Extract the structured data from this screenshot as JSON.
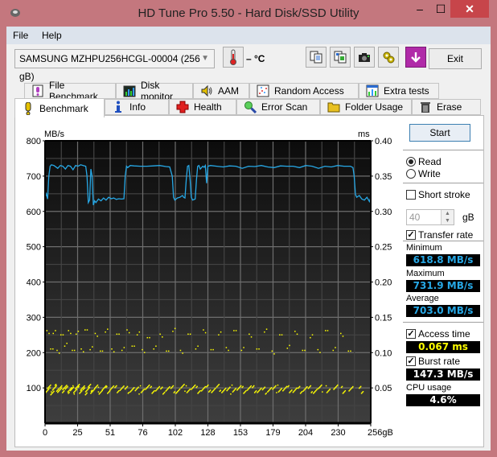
{
  "window": {
    "title": "HD Tune Pro 5.50 - Hard Disk/SSD Utility",
    "minimize": "–",
    "maximize": "☐",
    "close": "✕"
  },
  "menu": [
    {
      "label": "File"
    },
    {
      "label": "Help"
    }
  ],
  "toolbar": {
    "drive": "SAMSUNG MZHPU256HCGL-00004 (256 gB)",
    "temperature": "– °C",
    "exit_label": "Exit",
    "icons": [
      "copy-text-icon",
      "copy-screenshot-icon",
      "camera-icon",
      "options-icon",
      "save-download-icon"
    ]
  },
  "tabs_top": [
    {
      "label": "File Benchmark",
      "icon": "file-benchmark-icon"
    },
    {
      "label": "Disk monitor",
      "icon": "disk-monitor-icon"
    },
    {
      "label": "AAM",
      "icon": "speaker-icon"
    },
    {
      "label": "Random Access",
      "icon": "random-access-icon"
    },
    {
      "label": "Extra tests",
      "icon": "extra-tests-icon"
    }
  ],
  "tabs_bottom": [
    {
      "label": "Benchmark",
      "icon": "exclamation-icon",
      "active": true
    },
    {
      "label": "Info",
      "icon": "info-icon"
    },
    {
      "label": "Health",
      "icon": "health-cross-icon"
    },
    {
      "label": "Error Scan",
      "icon": "magnifier-icon"
    },
    {
      "label": "Folder Usage",
      "icon": "folder-icon"
    },
    {
      "label": "Erase",
      "icon": "trash-icon"
    }
  ],
  "side": {
    "start_label": "Start",
    "read_label": "Read",
    "write_label": "Write",
    "mode": "read",
    "short_stroke_label": "Short stroke",
    "short_stroke_checked": false,
    "short_stroke_value": "40",
    "short_stroke_unit": "gB",
    "transfer_rate_label": "Transfer rate",
    "transfer_rate_checked": true,
    "minimum_label": "Minimum",
    "minimum_value": "618.8 MB/s",
    "maximum_label": "Maximum",
    "maximum_value": "731.9 MB/s",
    "average_label": "Average",
    "average_value": "703.0 MB/s",
    "access_time_label": "Access time",
    "access_time_checked": true,
    "access_time_value": "0.067 ms",
    "burst_rate_label": "Burst rate",
    "burst_rate_checked": true,
    "burst_rate_value": "147.3 MB/s",
    "cpu_usage_label": "CPU usage",
    "cpu_usage_value": "4.6%"
  },
  "colors": {
    "transfer_line": "#27a8e6",
    "access_dots": "#ffff00",
    "plot_bg_top": "#0c0c0c",
    "plot_bg_bottom": "#3e3e3e"
  },
  "chart_data": {
    "type": "line",
    "title": "",
    "xlabel": "gB",
    "ylabel": "MB/s",
    "y2label": "ms",
    "xlim": [
      0,
      256
    ],
    "ylim": [
      0,
      800
    ],
    "y2lim": [
      0,
      0.4
    ],
    "x_ticks": [
      "0",
      "25",
      "51",
      "76",
      "102",
      "128",
      "153",
      "179",
      "204",
      "230",
      "256gB"
    ],
    "y_ticks": [
      "100",
      "200",
      "300",
      "400",
      "500",
      "600",
      "700",
      "800"
    ],
    "y2_ticks": [
      "0.05",
      "0.10",
      "0.15",
      "0.20",
      "0.25",
      "0.30",
      "0.35",
      "0.40"
    ],
    "grid": true,
    "legend": "none",
    "series": [
      {
        "name": "Transfer rate (MB/s)",
        "axis": "left",
        "x": [
          0,
          1,
          2,
          3,
          4,
          5,
          7,
          10,
          12,
          14,
          16,
          18,
          20,
          22,
          24,
          26,
          28,
          30,
          32,
          33,
          34,
          35,
          36,
          37,
          38,
          39,
          40,
          42,
          44,
          46,
          48,
          50,
          52,
          54,
          56,
          58,
          60,
          62,
          63,
          64,
          65,
          67,
          70,
          75,
          80,
          85,
          90,
          95,
          98,
          100,
          101,
          102,
          104,
          106,
          108,
          109,
          110,
          111,
          112,
          113,
          114,
          115,
          116,
          118,
          119,
          120,
          121,
          122,
          124,
          125,
          126,
          127,
          128,
          130,
          135,
          140,
          145,
          150,
          155,
          160,
          165,
          170,
          175,
          180,
          185,
          190,
          195,
          200,
          205,
          210,
          215,
          220,
          225,
          230,
          235,
          240,
          242,
          243,
          244,
          245,
          247,
          249,
          251,
          253,
          255,
          256
        ],
        "values": [
          640,
          650,
          635,
          700,
          728,
          732,
          730,
          722,
          730,
          728,
          720,
          730,
          728,
          718,
          730,
          728,
          732,
          730,
          728,
          700,
          625,
          632,
          720,
          700,
          618,
          630,
          625,
          635,
          630,
          638,
          632,
          640,
          636,
          638,
          634,
          636,
          635,
          636,
          700,
          728,
          724,
          730,
          729,
          728,
          728,
          729,
          730,
          727,
          726,
          700,
          640,
          632,
          638,
          640,
          645,
          640,
          638,
          690,
          728,
          730,
          690,
          640,
          632,
          635,
          690,
          728,
          730,
          720,
          728,
          725,
          730,
          680,
          728,
          730,
          728,
          726,
          729,
          728,
          722,
          728,
          727,
          730,
          726,
          724,
          729,
          728,
          728,
          724,
          730,
          728,
          722,
          728,
          726,
          730,
          728,
          728,
          724,
          700,
          648,
          640,
          645,
          635,
          632,
          640,
          628,
          640
        ]
      },
      {
        "name": "Access time (ms)",
        "axis": "right",
        "type": "scatter",
        "description": "dense cluster ≈0.045–0.052 ms across 0–256 gB (thinning after ~215 gB); sparse band ≈0.100–0.135 ms",
        "x": [
          1,
          3,
          5,
          7,
          9,
          11,
          13,
          15,
          17,
          19,
          21,
          23,
          25,
          27,
          29,
          31,
          33,
          35,
          37,
          40,
          43,
          46,
          49,
          52,
          56,
          60,
          64,
          68,
          72,
          76,
          80,
          84,
          88,
          92,
          96,
          100,
          104,
          108,
          112,
          116,
          120,
          124,
          128,
          132,
          136,
          140,
          144,
          148,
          152,
          156,
          160,
          164,
          168,
          172,
          176,
          180,
          184,
          188,
          192,
          196,
          200,
          204,
          208,
          212,
          216,
          222,
          228,
          234,
          240,
          248
        ],
        "values": [
          0.048,
          0.05,
          0.046,
          0.049,
          0.051,
          0.047,
          0.049,
          0.052,
          0.048,
          0.05,
          0.047,
          0.049,
          0.051,
          0.048,
          0.05,
          0.046,
          0.049,
          0.051,
          0.048,
          0.05,
          0.047,
          0.049,
          0.048,
          0.05,
          0.049,
          0.051,
          0.048,
          0.05,
          0.047,
          0.049,
          0.05,
          0.048,
          0.049,
          0.047,
          0.05,
          0.049,
          0.048,
          0.051,
          0.049,
          0.05,
          0.048,
          0.049,
          0.05,
          0.048,
          0.051,
          0.049,
          0.047,
          0.05,
          0.049,
          0.048,
          0.05,
          0.049,
          0.048,
          0.047,
          0.05,
          0.049,
          0.05,
          0.048,
          0.049,
          0.047,
          0.048,
          0.05,
          0.049,
          0.048,
          0.05,
          0.049,
          0.05,
          0.048,
          0.049,
          0.048
        ],
        "high_x": [
          1,
          4,
          6,
          9,
          12,
          15,
          18,
          21,
          24,
          28,
          31,
          35,
          39,
          43,
          47,
          52,
          56,
          60,
          64,
          68,
          72,
          76,
          80,
          85,
          90,
          95,
          100,
          106,
          112,
          118,
          124,
          130,
          136,
          142,
          148,
          154,
          160,
          166,
          172,
          178,
          184,
          190,
          196,
          202,
          208,
          214,
          220,
          226,
          232,
          238
        ],
        "high_values": [
          0.132,
          0.106,
          0.128,
          0.104,
          0.126,
          0.11,
          0.132,
          0.104,
          0.127,
          0.106,
          0.133,
          0.105,
          0.128,
          0.103,
          0.13,
          0.106,
          0.127,
          0.104,
          0.133,
          0.11,
          0.126,
          0.105,
          0.122,
          0.106,
          0.127,
          0.103,
          0.131,
          0.104,
          0.127,
          0.106,
          0.133,
          0.105,
          0.126,
          0.108,
          0.132,
          0.104,
          0.127,
          0.106,
          0.13,
          0.103,
          0.126,
          0.107,
          0.131,
          0.104,
          0.122,
          0.105,
          0.132,
          0.104,
          0.128,
          0.103
        ]
      }
    ]
  }
}
